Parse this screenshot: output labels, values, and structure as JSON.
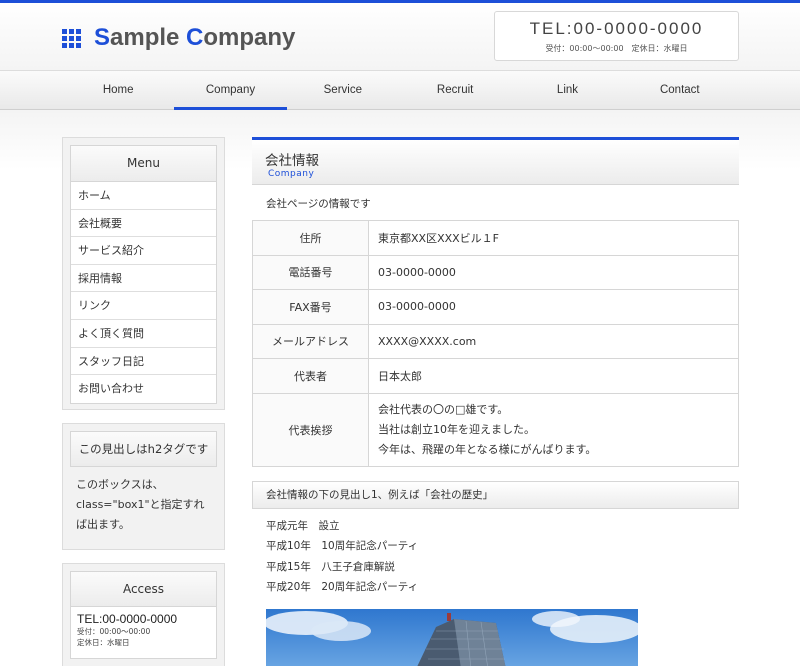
{
  "colors": {
    "accent": "#1d4fd8",
    "sky": "#3d86d6"
  },
  "header": {
    "logo_part1_cap": "S",
    "logo_part1_rest": "ample ",
    "logo_part2_cap": "C",
    "logo_part2_rest": "ompany",
    "tel": "TEL:00-0000-0000",
    "hours": "受付：00:00〜00:00　定休日：水曜日"
  },
  "nav": {
    "items": [
      {
        "label": "Home"
      },
      {
        "label": "Company"
      },
      {
        "label": "Service"
      },
      {
        "label": "Recruit"
      },
      {
        "label": "Link"
      },
      {
        "label": "Contact"
      }
    ],
    "active": "Company"
  },
  "sidebar": {
    "menu_title": "Menu",
    "menu": [
      {
        "label": "ホーム"
      },
      {
        "label": "会社概要"
      },
      {
        "label": "サービス紹介"
      },
      {
        "label": "採用情報"
      },
      {
        "label": "リンク"
      },
      {
        "label": "よく頂く質問"
      },
      {
        "label": "スタッフ日記"
      },
      {
        "label": "お問い合わせ"
      }
    ],
    "box1_title": "この見出しはh2タグです",
    "box1_text": "このボックスは、class=\"box1\"と指定すれば出ます。",
    "access_title": "Access",
    "access_tel": "TEL:00-0000-0000",
    "access_hours": "受付：00:00〜00:00",
    "access_holiday": "定休日：水曜日"
  },
  "main": {
    "title": "会社情報",
    "subtitle": "Company",
    "intro": "会社ページの情報です",
    "table": [
      {
        "label": "住所",
        "value": "東京都XX区XXXビル１F"
      },
      {
        "label": "電話番号",
        "value": "03-0000-0000"
      },
      {
        "label": "FAX番号",
        "value": "03-0000-0000"
      },
      {
        "label": "メールアドレス",
        "value": "XXXX@XXXX.com"
      },
      {
        "label": "代表者",
        "value": "日本太郎"
      }
    ],
    "greeting_label": "代表挨拶",
    "greeting_lines": [
      "会社代表の〇の□雄です。",
      "当社は創立10年を迎えました。",
      "今年は、飛躍の年となる様にがんばります。"
    ],
    "h3": "会社情報の下の見出し1、例えば「会社の歴史」",
    "history": [
      "平成元年　設立",
      "平成10年　10周年記念パーティ",
      "平成15年　八王子倉庫解説",
      "平成20年　20周年記念パーティ"
    ]
  }
}
